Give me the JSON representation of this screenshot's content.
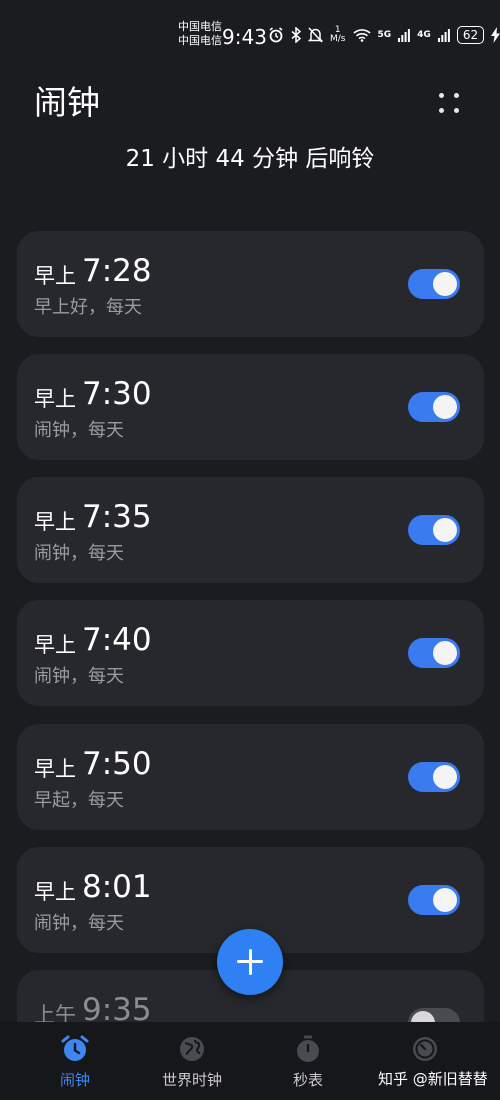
{
  "status_bar": {
    "carrier_1": "中国电信",
    "carrier_2": "中国电信",
    "time": "9:43",
    "speed_value": "1",
    "speed_unit": "M/s",
    "net_1": "5G",
    "net_2": "4G",
    "battery": "62",
    "icons": [
      "alarm-icon",
      "bluetooth-icon",
      "mute-icon",
      "wifi-icon",
      "signal-icon",
      "charging-icon"
    ]
  },
  "header": {
    "title": "闹钟",
    "countdown": "21 小时 44 分钟 后响铃"
  },
  "alarms": [
    {
      "period": "早上",
      "time": "7:28",
      "label": "早上好，每天",
      "enabled": true
    },
    {
      "period": "早上",
      "time": "7:30",
      "label": "闹钟，每天",
      "enabled": true
    },
    {
      "period": "早上",
      "time": "7:35",
      "label": "闹钟，每天",
      "enabled": true
    },
    {
      "period": "早上",
      "time": "7:40",
      "label": "闹钟，每天",
      "enabled": true
    },
    {
      "period": "早上",
      "time": "7:50",
      "label": "早起，每天",
      "enabled": true
    },
    {
      "period": "早上",
      "time": "8:01",
      "label": "闹钟，每天",
      "enabled": true
    },
    {
      "period": "上午",
      "time": "9:35",
      "label": "",
      "enabled": false
    }
  ],
  "nav": {
    "items": [
      {
        "label": "闹钟",
        "icon": "alarm-clock-icon",
        "active": true
      },
      {
        "label": "世界时钟",
        "icon": "globe-icon",
        "active": false
      },
      {
        "label": "秒表",
        "icon": "stopwatch-icon",
        "active": false
      },
      {
        "label": "",
        "icon": "timer-icon",
        "active": false
      }
    ]
  },
  "watermark": "知乎 @新旧替替",
  "colors": {
    "background": "#1b1c20",
    "card": "#27282d",
    "accent": "#2f80f2",
    "toggle_on": "#3a7bf0",
    "secondary_text": "#9a9ba0"
  }
}
